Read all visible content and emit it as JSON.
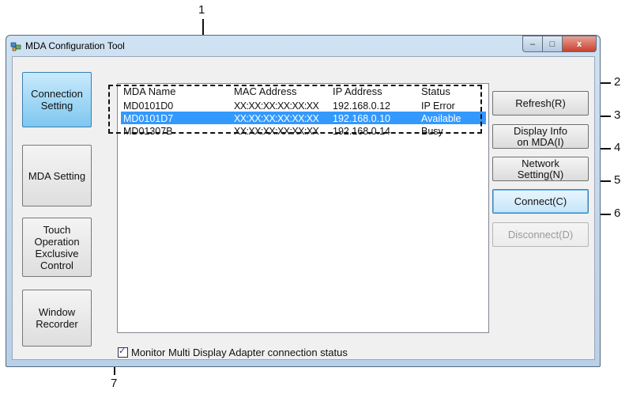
{
  "callouts": [
    "1",
    "2",
    "3",
    "4",
    "5",
    "6",
    "7"
  ],
  "window": {
    "title": "MDA Configuration Tool",
    "min_glyph": "–",
    "max_glyph": "□",
    "close_glyph": "x"
  },
  "sidebar": {
    "connection": "Connection\nSetting",
    "mda": "MDA Setting",
    "touch": "Touch\nOperation\nExclusive\nControl",
    "recorder": "Window\nRecorder"
  },
  "table": {
    "headers": [
      "MDA Name",
      "MAC Address",
      "IP Address",
      "Status"
    ],
    "rows": [
      {
        "name": "MD0101D0",
        "mac": "XX:XX:XX:XX:XX:XX",
        "ip": "192.168.0.12",
        "status": "IP Error"
      },
      {
        "name": "MD0101D7",
        "mac": "XX:XX:XX:XX:XX:XX",
        "ip": "192.168.0.10",
        "status": "Available"
      },
      {
        "name": "MD01307B",
        "mac": "XX:XX:XX:XX:XX:XX",
        "ip": "192.168.0.14",
        "status": "Busy"
      }
    ]
  },
  "buttons": {
    "refresh": "Refresh(R)",
    "display_info": "Display Info\non MDA(I)",
    "network": "Network\nSetting(N)",
    "connect": "Connect(C)",
    "disconnect": "Disconnect(D)"
  },
  "monitor": {
    "label": "Monitor Multi Display Adapter connection status",
    "checked": true,
    "check_glyph": "✓"
  }
}
